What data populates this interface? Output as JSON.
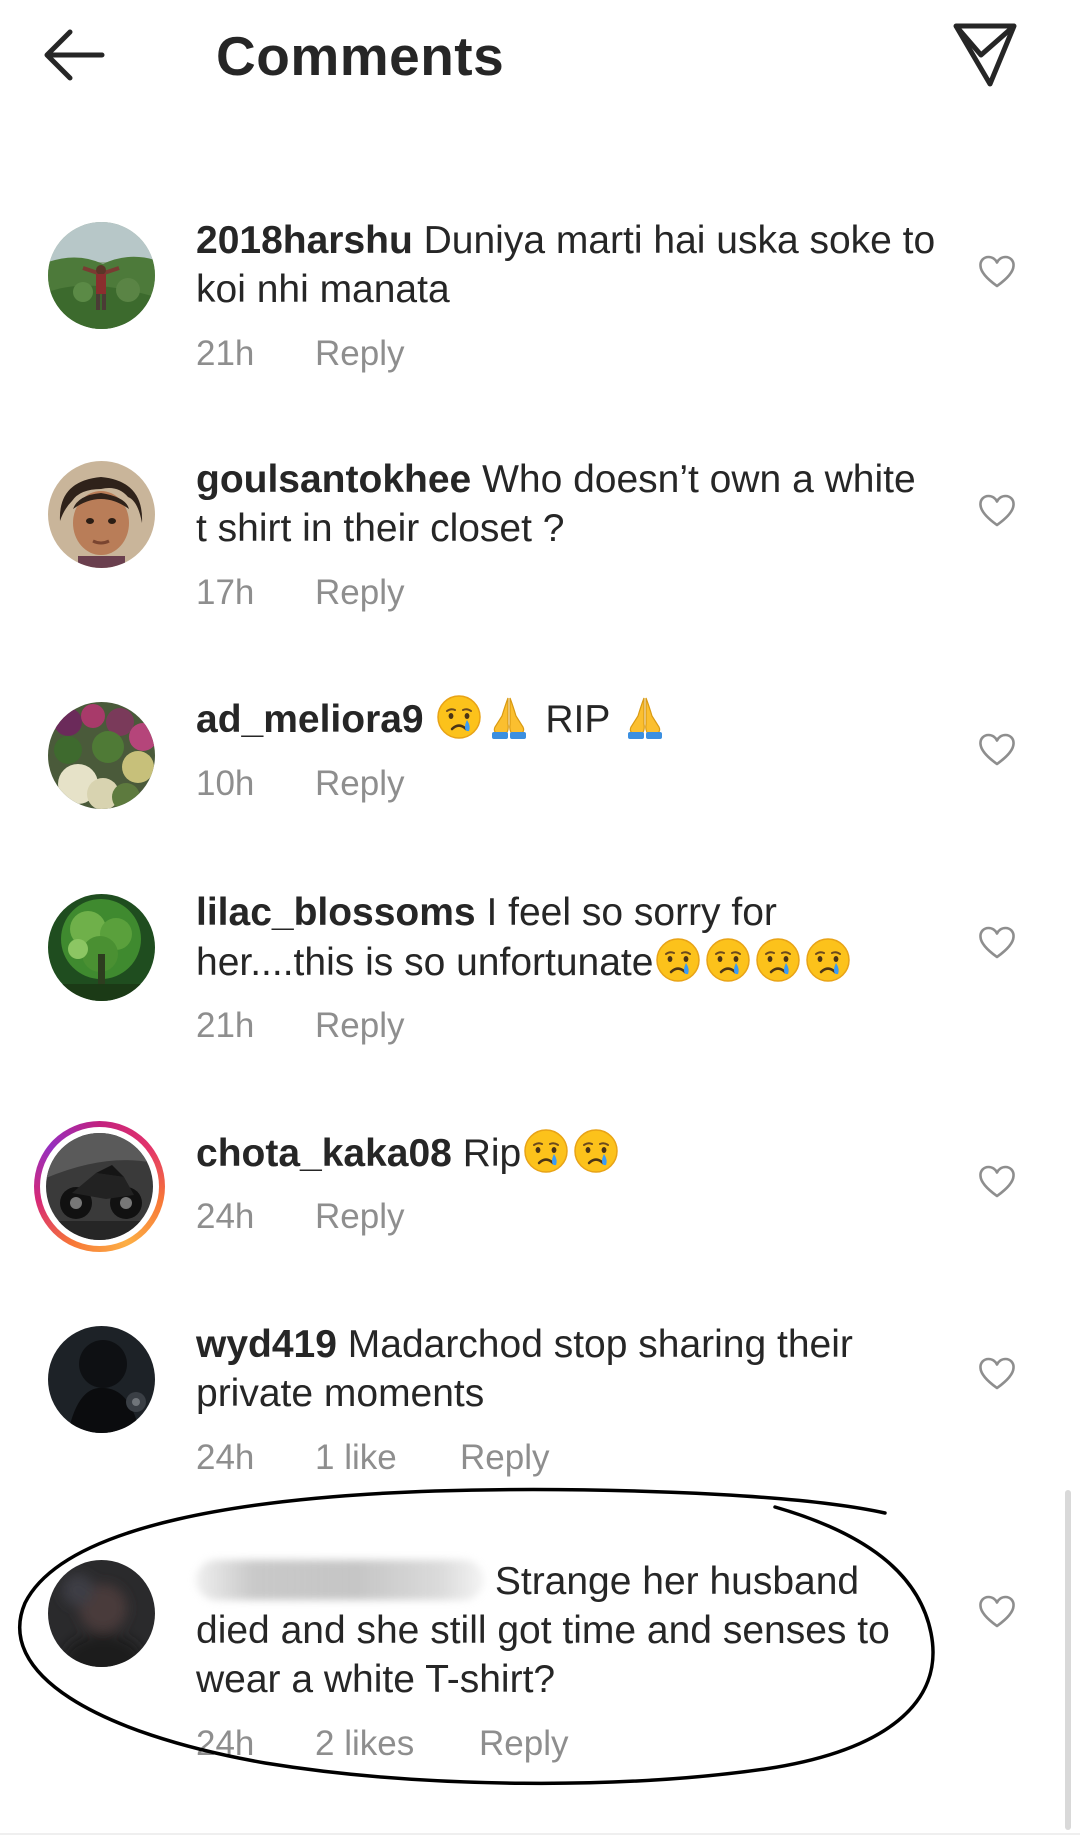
{
  "header": {
    "title": "Comments",
    "back_icon": "arrow-left-icon",
    "share_icon": "paper-plane-icon"
  },
  "comments": [
    {
      "username": "2018harshu",
      "text": "Duniya marti hai uska soke to koi nhi manata",
      "time": "21h",
      "reply": "Reply"
    },
    {
      "username": "goulsantokhee",
      "text": "Who doesn’t own a white t shirt in their closet ?",
      "time": "17h",
      "reply": "Reply"
    },
    {
      "username": "ad_meliora9",
      "text": "RIP",
      "time": "10h",
      "reply": "Reply"
    },
    {
      "username": "lilac_blossoms",
      "text": "I feel so sorry for her....this is so unfortunate",
      "time": "21h",
      "reply": "Reply"
    },
    {
      "username": "chota_kaka08",
      "text": "Rip",
      "time": "24h",
      "reply": "Reply"
    },
    {
      "username": "wyd419",
      "text": "Madarchod stop sharing their private moments",
      "time": "24h",
      "likes": "1 like",
      "reply": "Reply"
    },
    {
      "username": "",
      "text": "Strange her husband died and she still got time and senses to wear a white T-shirt?",
      "time": "24h",
      "likes": "2 likes",
      "reply": "Reply"
    }
  ],
  "colors": {
    "text": "#262626",
    "meta": "#8e8e8e",
    "story_ring": [
      "#c2217f",
      "#f77737",
      "#fcaf45",
      "#962fbf"
    ]
  },
  "icons": {
    "heart": "heart-outline-icon",
    "crying": "crying-face-emoji",
    "folded_hands": "folded-hands-emoji"
  }
}
